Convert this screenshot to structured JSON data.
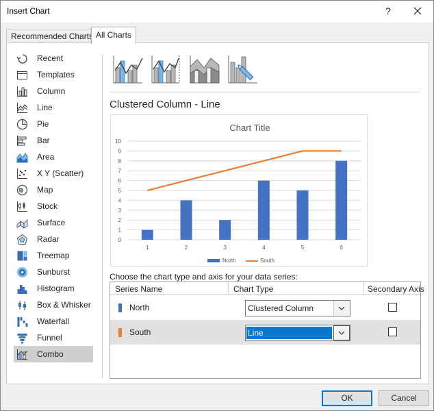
{
  "window": {
    "title": "Insert Chart",
    "help_glyph": "?"
  },
  "tabs": [
    {
      "label": "Recommended Charts",
      "active": false
    },
    {
      "label": "All Charts",
      "active": true
    }
  ],
  "sidebar": {
    "items": [
      {
        "label": "Recent",
        "icon": "recent-icon"
      },
      {
        "label": "Templates",
        "icon": "templates-icon"
      },
      {
        "label": "Column",
        "icon": "column-chart-icon"
      },
      {
        "label": "Line",
        "icon": "line-chart-icon"
      },
      {
        "label": "Pie",
        "icon": "pie-chart-icon"
      },
      {
        "label": "Bar",
        "icon": "bar-chart-icon"
      },
      {
        "label": "Area",
        "icon": "area-chart-icon"
      },
      {
        "label": "X Y (Scatter)",
        "icon": "scatter-chart-icon"
      },
      {
        "label": "Map",
        "icon": "map-chart-icon"
      },
      {
        "label": "Stock",
        "icon": "stock-chart-icon"
      },
      {
        "label": "Surface",
        "icon": "surface-chart-icon"
      },
      {
        "label": "Radar",
        "icon": "radar-chart-icon"
      },
      {
        "label": "Treemap",
        "icon": "treemap-chart-icon"
      },
      {
        "label": "Sunburst",
        "icon": "sunburst-chart-icon"
      },
      {
        "label": "Histogram",
        "icon": "histogram-chart-icon"
      },
      {
        "label": "Box & Whisker",
        "icon": "box-whisker-chart-icon"
      },
      {
        "label": "Waterfall",
        "icon": "waterfall-chart-icon"
      },
      {
        "label": "Funnel",
        "icon": "funnel-chart-icon"
      },
      {
        "label": "Combo",
        "icon": "combo-chart-icon",
        "selected": true
      }
    ]
  },
  "subtypes": [
    {
      "icon": "clustered-column-line-icon",
      "selected": true
    },
    {
      "icon": "clustered-column-line-secondary-axis-icon",
      "selected": false
    },
    {
      "icon": "stacked-area-clustered-column-icon",
      "selected": false
    },
    {
      "icon": "custom-combination-icon",
      "selected": false
    }
  ],
  "subtype_title": "Clustered Column - Line",
  "chart_data": {
    "type": "bar",
    "title": "Chart Title",
    "categories": [
      "1",
      "2",
      "3",
      "4",
      "5",
      "6"
    ],
    "series": [
      {
        "name": "North",
        "render": "column",
        "color": "#4472c4",
        "values": [
          1,
          4,
          2,
          6,
          5,
          8
        ]
      },
      {
        "name": "South",
        "render": "line",
        "color": "#ed7d31",
        "values": [
          5,
          6,
          7,
          8,
          9,
          9
        ]
      }
    ],
    "ylim": [
      0,
      10
    ],
    "yticks": [
      "0",
      "1",
      "2",
      "3",
      "4",
      "5",
      "6",
      "7",
      "8",
      "9",
      "10"
    ],
    "grid": true,
    "legend": "bottom"
  },
  "series_config": {
    "caption": "Choose the chart type and axis for your data series:",
    "headers": {
      "name": "Series Name",
      "type": "Chart Type",
      "secondary": "Secondary Axis"
    },
    "rows": [
      {
        "name": "North",
        "color": "#4472c4",
        "chart_type": "Clustered Column",
        "secondary": false,
        "selected": false
      },
      {
        "name": "South",
        "color": "#ed7d31",
        "chart_type": "Line",
        "secondary": false,
        "selected": true
      }
    ]
  },
  "footer": {
    "ok_label": "OK",
    "cancel_label": "Cancel"
  }
}
